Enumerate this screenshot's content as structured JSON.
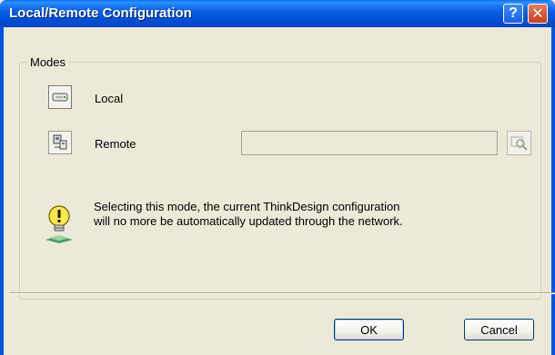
{
  "window": {
    "title": "Local/Remote Configuration",
    "help_glyph": "?",
    "close_glyph": "✕"
  },
  "modes": {
    "group_label": "Modes",
    "local_label": "Local",
    "remote_label": "Remote",
    "server_value": "",
    "local_icon": "local-drive-icon",
    "remote_icon": "remote-computer-icon",
    "browse_icon": "browse-search-icon"
  },
  "info": {
    "icon": "info-bulb-icon",
    "message": "Selecting this mode, the current ThinkDesign configuration will no more be automatically updated through the network."
  },
  "buttons": {
    "ok_label": "OK",
    "cancel_label": "Cancel"
  },
  "colors": {
    "titlebar": "#0054e3",
    "dialog_bg": "#ece9d8",
    "close_button": "#c9401a"
  }
}
